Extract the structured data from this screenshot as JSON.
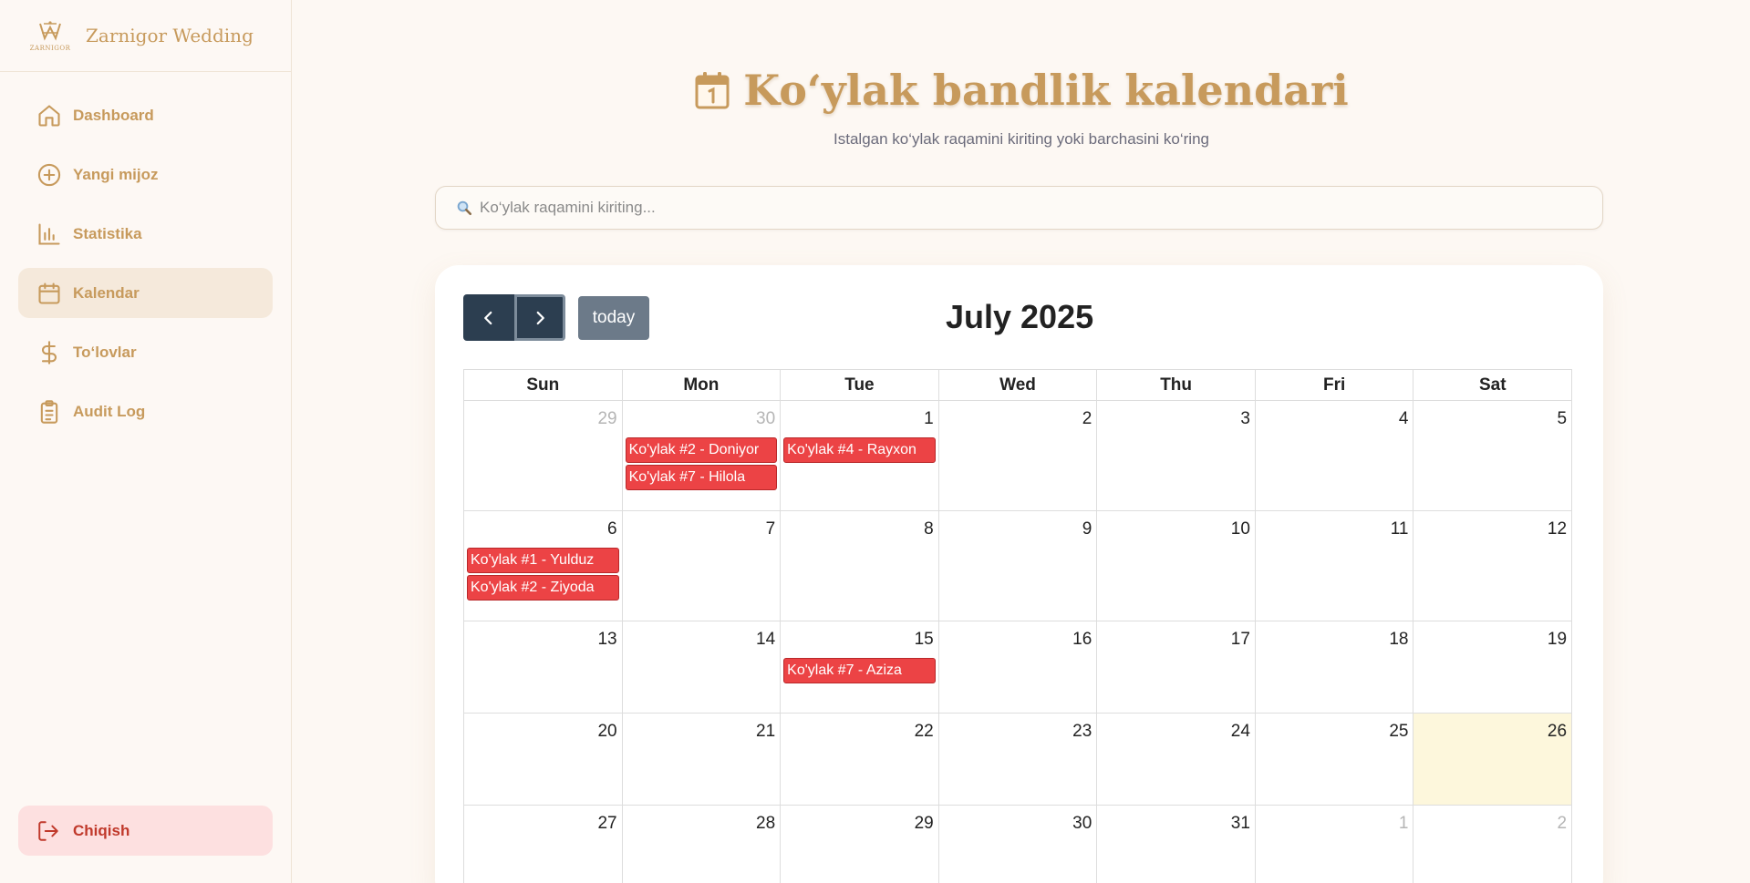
{
  "brand": {
    "name": "Zarnigor Wedding",
    "logo_text": "ZARNIGOR"
  },
  "sidebar": {
    "items": [
      {
        "label": "Dashboard",
        "icon": "home-icon",
        "active": false
      },
      {
        "label": "Yangi mijoz",
        "icon": "plus-circle-icon",
        "active": false
      },
      {
        "label": "Statistika",
        "icon": "bar-chart-icon",
        "active": false
      },
      {
        "label": "Kalendar",
        "icon": "calendar-icon",
        "active": true
      },
      {
        "label": "To‘lovlar",
        "icon": "dollar-icon",
        "active": false
      },
      {
        "label": "Audit Log",
        "icon": "clipboard-icon",
        "active": false
      }
    ],
    "logout_label": "Chiqish"
  },
  "header": {
    "title": "Ko‘ylak bandlik kalendari",
    "subtitle": "Istalgan ko‘ylak raqamini kiriting yoki barchasini ko‘ring"
  },
  "search": {
    "placeholder": "Ko‘ylak raqamini kiriting...",
    "value": ""
  },
  "calendar": {
    "today_label": "today",
    "month_title": "July 2025",
    "days_of_week": [
      "Sun",
      "Mon",
      "Tue",
      "Wed",
      "Thu",
      "Fri",
      "Sat"
    ],
    "weeks": [
      [
        {
          "num": "29",
          "other": true,
          "events": []
        },
        {
          "num": "30",
          "other": true,
          "events": [
            "Ko'ylak #2 - Doniyor",
            "Ko'ylak #7 - Hilola"
          ]
        },
        {
          "num": "1",
          "other": false,
          "events": [
            "Ko'ylak #4 - Rayxon"
          ]
        },
        {
          "num": "2",
          "other": false,
          "events": []
        },
        {
          "num": "3",
          "other": false,
          "events": []
        },
        {
          "num": "4",
          "other": false,
          "events": []
        },
        {
          "num": "5",
          "other": false,
          "events": []
        }
      ],
      [
        {
          "num": "6",
          "other": false,
          "events": [
            "Ko'ylak #1 - Yulduz",
            "Ko'ylak #2 - Ziyoda"
          ]
        },
        {
          "num": "7",
          "other": false,
          "events": []
        },
        {
          "num": "8",
          "other": false,
          "events": []
        },
        {
          "num": "9",
          "other": false,
          "events": []
        },
        {
          "num": "10",
          "other": false,
          "events": []
        },
        {
          "num": "11",
          "other": false,
          "events": []
        },
        {
          "num": "12",
          "other": false,
          "events": []
        }
      ],
      [
        {
          "num": "13",
          "other": false,
          "events": []
        },
        {
          "num": "14",
          "other": false,
          "events": []
        },
        {
          "num": "15",
          "other": false,
          "events": [
            "Ko'ylak #7 - Aziza"
          ]
        },
        {
          "num": "16",
          "other": false,
          "events": []
        },
        {
          "num": "17",
          "other": false,
          "events": []
        },
        {
          "num": "18",
          "other": false,
          "events": []
        },
        {
          "num": "19",
          "other": false,
          "events": []
        }
      ],
      [
        {
          "num": "20",
          "other": false,
          "events": []
        },
        {
          "num": "21",
          "other": false,
          "events": []
        },
        {
          "num": "22",
          "other": false,
          "events": []
        },
        {
          "num": "23",
          "other": false,
          "events": []
        },
        {
          "num": "24",
          "other": false,
          "events": []
        },
        {
          "num": "25",
          "other": false,
          "events": []
        },
        {
          "num": "26",
          "other": false,
          "today": true,
          "events": []
        }
      ],
      [
        {
          "num": "27",
          "other": false,
          "events": []
        },
        {
          "num": "28",
          "other": false,
          "events": []
        },
        {
          "num": "29",
          "other": false,
          "events": []
        },
        {
          "num": "30",
          "other": false,
          "events": []
        },
        {
          "num": "31",
          "other": false,
          "events": []
        },
        {
          "num": "1",
          "other": true,
          "events": []
        },
        {
          "num": "2",
          "other": true,
          "events": []
        }
      ]
    ]
  },
  "colors": {
    "accent": "#c79a5c",
    "event": "#ec4345",
    "nav_button": "#2c3e50",
    "today_bg": "#fdf7dc"
  }
}
